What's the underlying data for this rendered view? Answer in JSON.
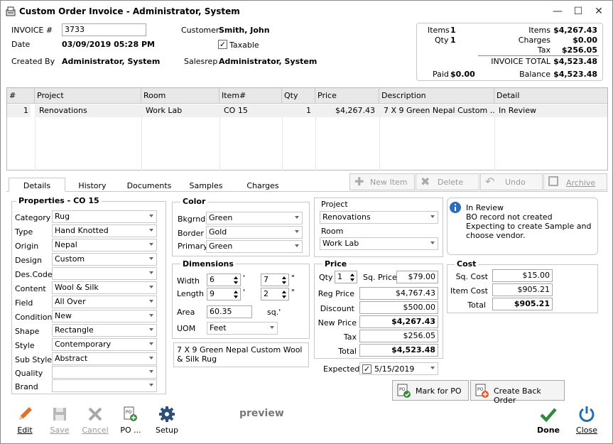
{
  "window": {
    "title": "Custom Order Invoice - Administrator, System",
    "min": "—",
    "max": "☐",
    "close": "✕"
  },
  "header": {
    "invoice_label": "INVOICE #",
    "invoice_value": "3733",
    "date_label": "Date",
    "date_value": "03/09/2019 05:28 PM",
    "created_label": "Created By",
    "created_value": "Administrator, System",
    "customer_label": "Customer",
    "customer_value": "Smith, John",
    "taxable_label": "Taxable",
    "taxable_checked": true,
    "salesrep_label": "Salesrep",
    "salesrep_value": "Administrator, System"
  },
  "summary": {
    "items_label": "Items",
    "items_value": "1",
    "qty_label": "Qty",
    "qty_value": "1",
    "items_amt_label": "Items",
    "items_amt": "$4,267.43",
    "charges_label": "Charges",
    "charges_amt": "$0.00",
    "tax_label": "Tax",
    "tax_amt": "$256.05",
    "total_label": "INVOICE TOTAL",
    "total_amt": "$4,523.48",
    "paid_label": "Paid",
    "paid_amt": "$0.00",
    "balance_label": "Balance",
    "balance_amt": "$4,523.48"
  },
  "grid": {
    "headers": [
      "#",
      "Project",
      "Room",
      "Item#",
      "Qty",
      "Price",
      "Description",
      "Detail"
    ],
    "rows": [
      [
        "1",
        "Renovations",
        "Work Lab",
        "CO 15",
        "1",
        "$4,267.43",
        "7 X 9 Green Nepal Custom ...",
        "In Review"
      ]
    ]
  },
  "tabs": [
    "Details",
    "History",
    "Documents",
    "Samples",
    "Charges"
  ],
  "toolbar_top": {
    "new_item": "New Item",
    "delete": "Delete",
    "undo": "Undo",
    "archive": "Archive"
  },
  "properties": {
    "title": "Properties - CO 15",
    "fields": [
      {
        "label": "Category",
        "value": "Rug"
      },
      {
        "label": "Type",
        "value": "Hand Knotted"
      },
      {
        "label": "Origin",
        "value": "Nepal"
      },
      {
        "label": "Design",
        "value": "Custom"
      },
      {
        "label": "Des.Code",
        "value": ""
      },
      {
        "label": "Content",
        "value": "Wool & Silk"
      },
      {
        "label": "Field",
        "value": "All Over"
      },
      {
        "label": "Condition",
        "value": "New"
      },
      {
        "label": "Shape",
        "value": "Rectangle"
      },
      {
        "label": "Style",
        "value": "Contemporary"
      },
      {
        "label": "Sub Style",
        "value": "Abstract"
      },
      {
        "label": "Quality",
        "value": ""
      },
      {
        "label": "Brand",
        "value": ""
      }
    ]
  },
  "color": {
    "title": "Color",
    "bkgrnd_label": "Bkgrnd",
    "bkgrnd": "Green",
    "border_label": "Border",
    "border": "Gold",
    "primary_label": "Primary",
    "primary": "Green"
  },
  "dimensions": {
    "title": "Dimensions",
    "width_label": "Width",
    "width_ft": "6",
    "width_in": "7",
    "length_label": "Length",
    "length_ft": "9",
    "length_in": "2",
    "ft_mark": "'",
    "in_mark": "\"",
    "area_label": "Area",
    "area": "60.35",
    "area_unit": "sq.'",
    "uom_label": "UOM",
    "uom": "Feet"
  },
  "description": "7 X 9 Green Nepal Custom Wool & Silk Rug",
  "project": {
    "project_label": "Project",
    "project": "Renovations",
    "room_label": "Room",
    "room": "Work Lab"
  },
  "price": {
    "title": "Price",
    "qty_label": "Qty",
    "qty": "1",
    "sqprice_label": "Sq. Price",
    "sqprice": "$79.00",
    "reg_label": "Reg Price",
    "reg": "$4,767.43",
    "disc_label": "Discount",
    "disc": "$500.00",
    "new_label": "New Price",
    "new": "$4,267.43",
    "tax_label": "Tax",
    "tax": "$256.05",
    "total_label": "Total",
    "total": "$4,523.48"
  },
  "expected": {
    "label": "Expected",
    "date": "5/15/2019",
    "checked": true
  },
  "info": {
    "line1": "In Review",
    "line2": "BO record not created",
    "line3": "Expecting to create Sample and choose vendor."
  },
  "cost": {
    "title": "Cost",
    "sq_label": "Sq. Cost",
    "sq": "$15.00",
    "item_label": "Item Cost",
    "item": "$905.21",
    "total_label": "Total",
    "total": "$905.21"
  },
  "actions": {
    "mark_po": "Mark for PO",
    "back_order": "Create Back Order"
  },
  "bottom": {
    "edit": "Edit",
    "save": "Save",
    "cancel": "Cancel",
    "po": "PO ...",
    "setup": "Setup",
    "preview": "preview",
    "done": "Done",
    "close": "Close"
  }
}
